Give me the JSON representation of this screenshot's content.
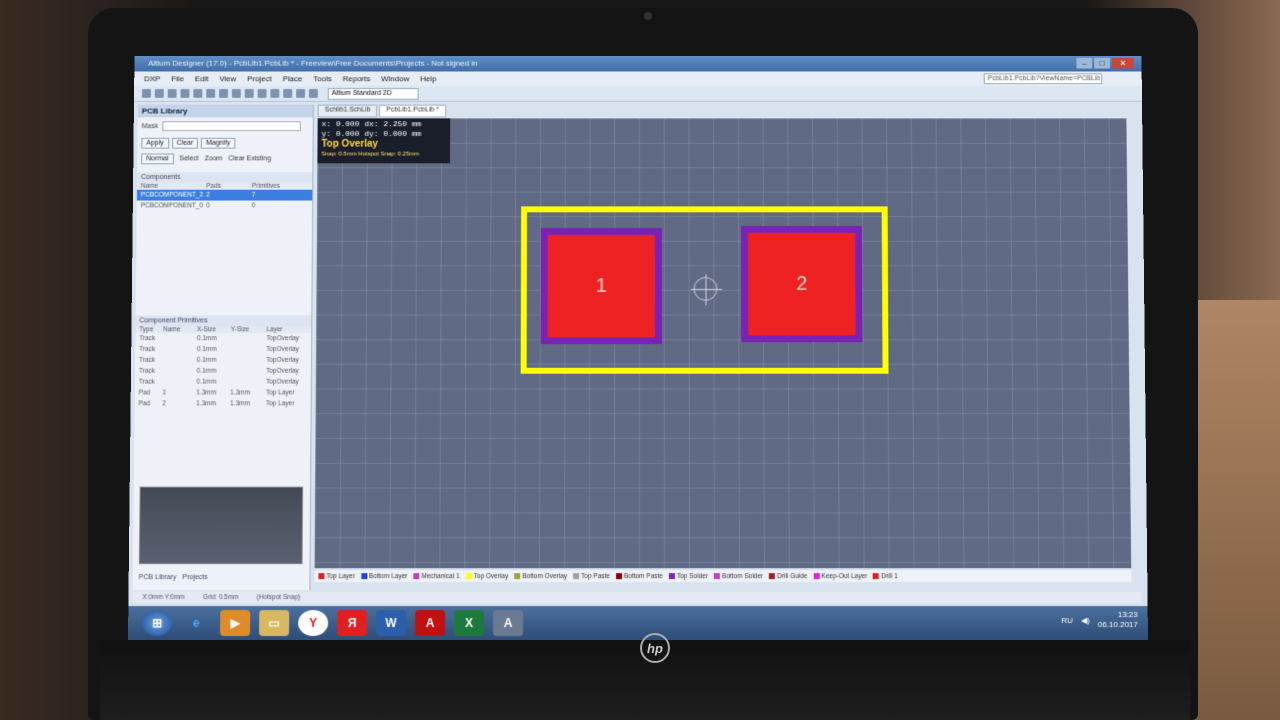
{
  "window": {
    "title": "Altium Designer (17.0) - PcbLib1.PcbLib * - Freeview\\Free Documents\\Projects - Not signed in"
  },
  "menu": [
    "DXP",
    "File",
    "Edit",
    "View",
    "Project",
    "Place",
    "Tools",
    "Reports",
    "Window",
    "Help"
  ],
  "menu_right": "PcbLib1.PcbLib?ViewName=PCBLib",
  "toolbar": {
    "view_mode": "Altium Standard 2D"
  },
  "panel": {
    "title": "PCB Library",
    "mask_label": "Mask",
    "buttons": {
      "apply": "Apply",
      "clear": "Clear",
      "magnify": "Magnify"
    },
    "options": {
      "mode": "Normal",
      "select": "Select",
      "zoom": "Zoom",
      "clear_existing": "Clear Existing"
    },
    "components_title": "Components",
    "components_headers": [
      "Name",
      "Pads",
      "Primitives"
    ],
    "components": [
      {
        "name": "PCBCOMPONENT_2",
        "pads": "2",
        "prims": "7"
      },
      {
        "name": "PCBCOMPONENT_0",
        "pads": "0",
        "prims": "0"
      }
    ],
    "primitives_title": "Component Primitives",
    "primitives_headers": [
      "Type",
      "Name",
      "X-Size",
      "Y-Size",
      "Layer"
    ],
    "primitives": [
      {
        "type": "Track",
        "name": "",
        "x": "0.1mm",
        "y": "",
        "layer": "TopOverlay"
      },
      {
        "type": "Track",
        "name": "",
        "x": "0.1mm",
        "y": "",
        "layer": "TopOverlay"
      },
      {
        "type": "Track",
        "name": "",
        "x": "0.1mm",
        "y": "",
        "layer": "TopOverlay"
      },
      {
        "type": "Track",
        "name": "",
        "x": "0.1mm",
        "y": "",
        "layer": "TopOverlay"
      },
      {
        "type": "Track",
        "name": "",
        "x": "0.1mm",
        "y": "",
        "layer": "TopOverlay"
      },
      {
        "type": "Pad",
        "name": "1",
        "x": "1.3mm",
        "y": "1.3mm",
        "layer": "Top Layer"
      },
      {
        "type": "Pad",
        "name": "2",
        "x": "1.3mm",
        "y": "1.3mm",
        "layer": "Top Layer"
      }
    ],
    "tabs": [
      "PCB Library",
      "Projects"
    ]
  },
  "doc_tabs": [
    "Schlib1.SchLib",
    "PcbLib1.PcbLib *"
  ],
  "coords": {
    "line1": "x: 0.000  dx: 2.250 mm",
    "line2": "y: 0.000  dy: 0.000 mm",
    "layer": "Top Overlay",
    "snap": "Snap: 0.5mm Hotspot Snap: 0.25mm"
  },
  "pads": [
    {
      "label": "1"
    },
    {
      "label": "2"
    }
  ],
  "layers": [
    {
      "name": "Top Layer",
      "color": "#e02020"
    },
    {
      "name": "Bottom Layer",
      "color": "#2040e0"
    },
    {
      "name": "Mechanical 1",
      "color": "#c040c0"
    },
    {
      "name": "Top Overlay",
      "color": "#ffff00"
    },
    {
      "name": "Bottom Overlay",
      "color": "#a0a040"
    },
    {
      "name": "Top Paste",
      "color": "#a0a0a0"
    },
    {
      "name": "Bottom Paste",
      "color": "#800000"
    },
    {
      "name": "Top Solder",
      "color": "#8020c0"
    },
    {
      "name": "Bottom Solder",
      "color": "#c040c0"
    },
    {
      "name": "Drill Guide",
      "color": "#a02020"
    },
    {
      "name": "Keep-Out Layer",
      "color": "#e020e0"
    },
    {
      "name": "Drill 1",
      "color": "#e02020"
    }
  ],
  "status": {
    "left": "X:0mm Y:0mm",
    "grid": "Grid: 0.5mm",
    "hotspot": "(Hotspot Snap)"
  },
  "tray": {
    "lang": "RU",
    "time": "13:23",
    "date": "06.10.2017"
  },
  "taskbar": [
    "start",
    "ie",
    "media",
    "explorer",
    "yandex-browser",
    "yandex",
    "word",
    "acrobat",
    "excel",
    "altium"
  ]
}
